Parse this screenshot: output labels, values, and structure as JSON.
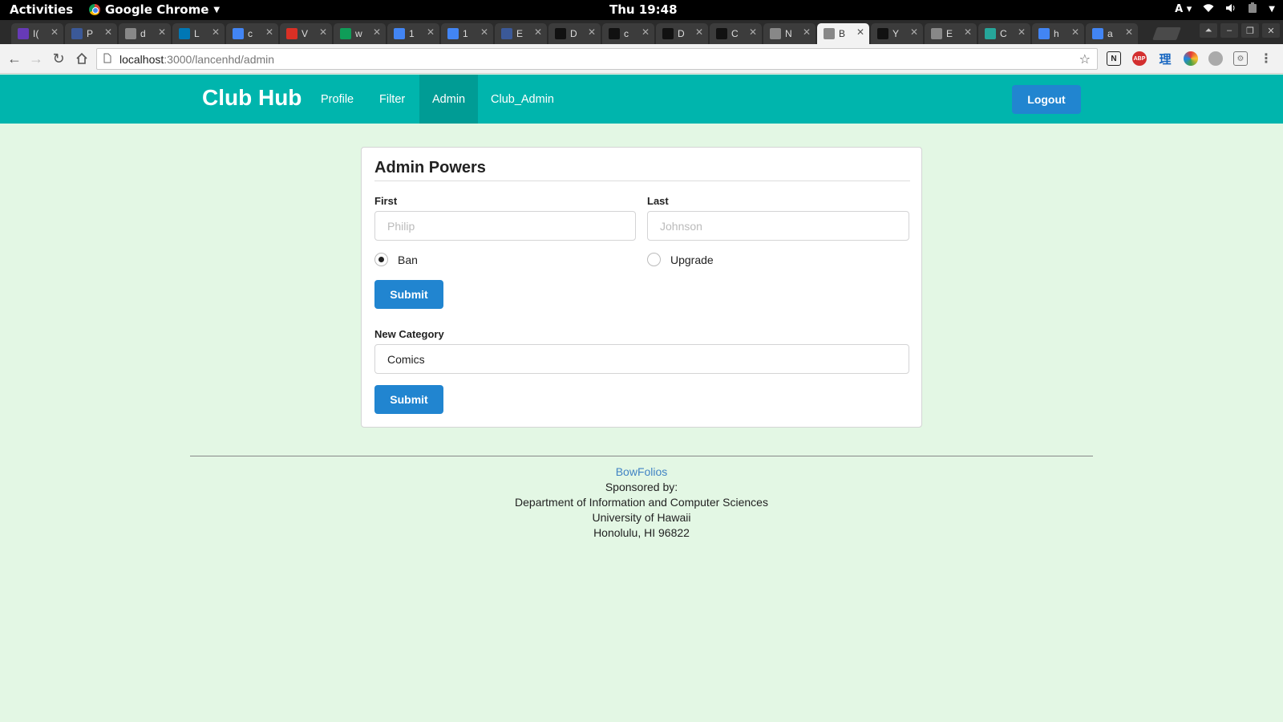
{
  "os_bar": {
    "activities": "Activities",
    "app_name": "Google Chrome",
    "clock": "Thu 19:48",
    "input_indicator": "A"
  },
  "browser": {
    "tabs": [
      {
        "letter": "I(",
        "color": "#673ab7"
      },
      {
        "letter": "P",
        "color": "#3b5998"
      },
      {
        "letter": "d",
        "color": "#888888"
      },
      {
        "letter": "L",
        "color": "#0077b5"
      },
      {
        "letter": "c",
        "color": "#4285f4"
      },
      {
        "letter": "V",
        "color": "#d93025"
      },
      {
        "letter": "w",
        "color": "#0f9d58"
      },
      {
        "letter": "1",
        "color": "#4285f4"
      },
      {
        "letter": "1",
        "color": "#4285f4"
      },
      {
        "letter": "E",
        "color": "#3b5998"
      },
      {
        "letter": "D",
        "color": "#111111"
      },
      {
        "letter": "c",
        "color": "#111111"
      },
      {
        "letter": "D",
        "color": "#111111"
      },
      {
        "letter": "C",
        "color": "#111111"
      },
      {
        "letter": "N",
        "color": "#888888"
      },
      {
        "letter": "B",
        "color": "#888888",
        "active": true
      },
      {
        "letter": "Y",
        "color": "#111111"
      },
      {
        "letter": "E",
        "color": "#888888"
      },
      {
        "letter": "C",
        "color": "#26a69a"
      },
      {
        "letter": "h",
        "color": "#4285f4"
      },
      {
        "letter": "a",
        "color": "#4285f4"
      }
    ],
    "url_host": "localhost",
    "url_path": ":3000/lancenhd/admin"
  },
  "navbar": {
    "brand": "Club Hub",
    "items": [
      {
        "label": "Profile",
        "active": false
      },
      {
        "label": "Filter",
        "active": false
      },
      {
        "label": "Admin",
        "active": true
      },
      {
        "label": "Club_Admin",
        "active": false
      }
    ],
    "logout_label": "Logout"
  },
  "admin_form": {
    "title": "Admin Powers",
    "first_label": "First",
    "first_placeholder": "Philip",
    "last_label": "Last",
    "last_placeholder": "Johnson",
    "radio_ban": "Ban",
    "radio_upgrade": "Upgrade",
    "selected_action": "Ban",
    "submit_label": "Submit"
  },
  "category_form": {
    "label": "New Category",
    "value": "Comics",
    "submit_label": "Submit"
  },
  "footer": {
    "link": "BowFolios",
    "line1": "Sponsored by:",
    "line2": "Department of Information and Computer Sciences",
    "line3": "University of Hawaii",
    "line4": "Honolulu, HI 96822"
  }
}
